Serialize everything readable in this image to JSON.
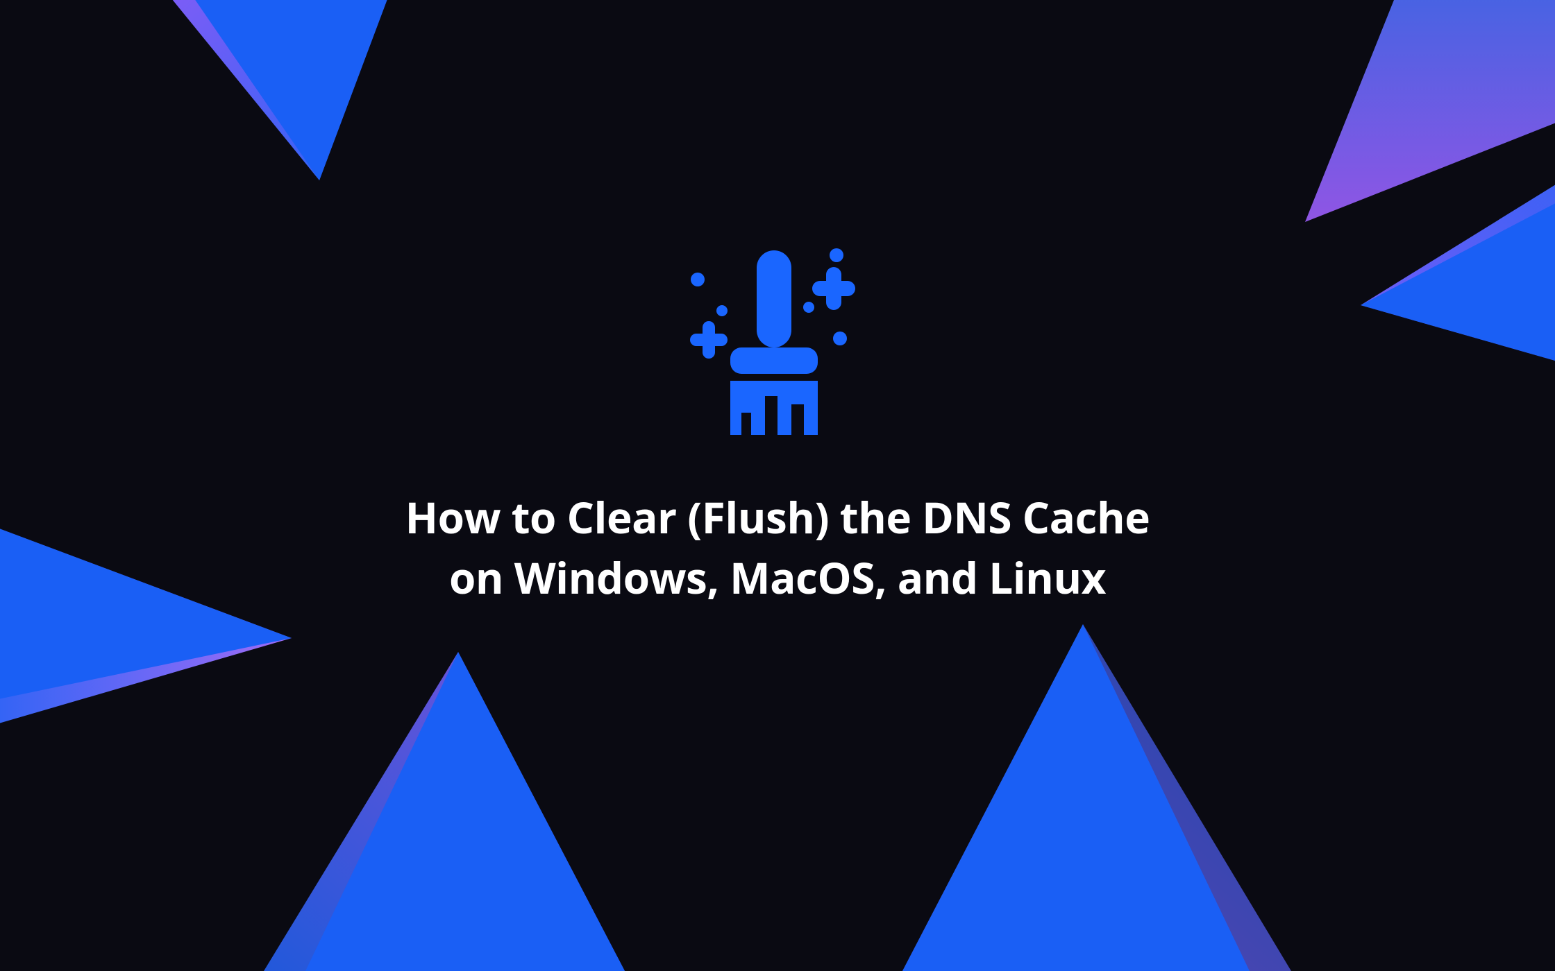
{
  "title": "How to Clear (Flush) the DNS Cache on Windows, MacOS, and Linux",
  "icon_name": "broom-clean-sparkle-icon",
  "colors": {
    "background": "#0a0a12",
    "accent_blue": "#1a66ff",
    "triangle_blue": "#2563f5",
    "triangle_purple": "#8b5cf6",
    "text": "#ffffff"
  }
}
